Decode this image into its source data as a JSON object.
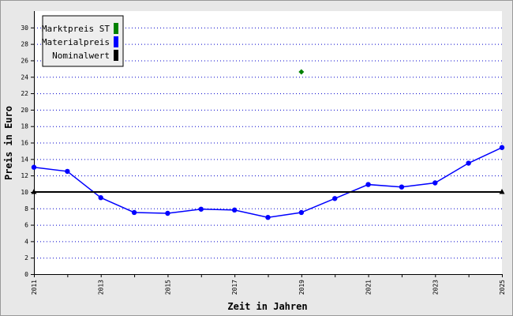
{
  "chart_data": {
    "type": "line",
    "title": "",
    "xlabel": "Zeit in Jahren",
    "ylabel": "Preis in Euro",
    "xlim": [
      2011,
      2025
    ],
    "ylim": [
      0,
      32
    ],
    "x_ticks": [
      2011,
      2013,
      2015,
      2017,
      2019,
      2021,
      2023,
      2025
    ],
    "y_ticks": [
      0,
      2,
      4,
      6,
      8,
      10,
      12,
      14,
      16,
      18,
      20,
      22,
      24,
      26,
      28,
      30
    ],
    "grid": "horizontal dotted",
    "legend_position": "top-left",
    "series": [
      {
        "name": "Marktpreis ST",
        "color": "#008000",
        "marker": "diamond",
        "x": [
          2019
        ],
        "y": [
          24.6
        ]
      },
      {
        "name": "Materialpreis",
        "color": "#0000ff",
        "marker": "circle",
        "x": [
          2011,
          2012,
          2013,
          2014,
          2015,
          2016,
          2017,
          2018,
          2019,
          2020,
          2021,
          2022,
          2023,
          2024,
          2025
        ],
        "y": [
          13.0,
          12.5,
          9.3,
          7.5,
          7.4,
          7.9,
          7.8,
          6.9,
          7.5,
          9.2,
          10.9,
          10.6,
          11.1,
          13.5,
          15.4
        ]
      },
      {
        "name": "Nominalwert",
        "color": "#000000",
        "marker": "triangle",
        "x": [
          2011,
          2025
        ],
        "y": [
          10,
          10
        ]
      }
    ]
  }
}
